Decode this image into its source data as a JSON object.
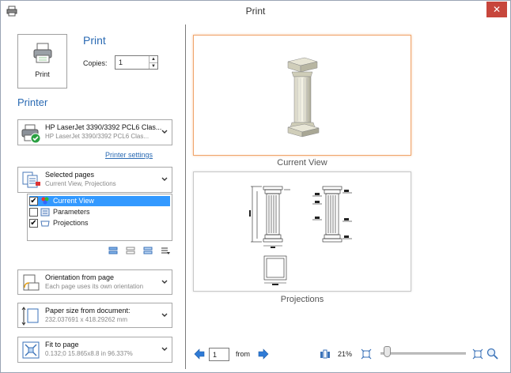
{
  "window": {
    "title": "Print"
  },
  "print": {
    "button_label": "Print",
    "heading": "Print",
    "copies_label": "Copies:",
    "copies_value": "1"
  },
  "printer": {
    "heading": "Printer",
    "name": "HP LaserJet 3390/3392 PCL6 Clas...",
    "name_sub": "HP LaserJet 3390/3392 PCL6 Clas...",
    "settings_link": "Printer settings"
  },
  "pages": {
    "selector_title": "Selected pages",
    "selector_sub": "Current View, Projections",
    "items": [
      {
        "label": "Current View",
        "checked": true,
        "selected": true
      },
      {
        "label": "Parameters",
        "checked": false,
        "selected": false
      },
      {
        "label": "Projections",
        "checked": true,
        "selected": false
      }
    ]
  },
  "orientation": {
    "title": "Orientation from page",
    "sub": "Each page uses its own orientation"
  },
  "paper": {
    "title": "Paper size from document:",
    "sub": "232.037691 x 418.29262 mm"
  },
  "fit": {
    "title": "Fit to page",
    "sub": "0.132;0   15.865x8.8 in 96.337%"
  },
  "preview": {
    "captions": [
      "Current View",
      "Projections"
    ]
  },
  "nav": {
    "page_value": "1",
    "from_label": "from",
    "zoom": "21%",
    "zoom_level": 0.03
  },
  "colors": {
    "accent": "#2a6ab3",
    "selected_page_border": "#f0a46a",
    "selection": "#3399ff",
    "close": "#c7463c"
  }
}
